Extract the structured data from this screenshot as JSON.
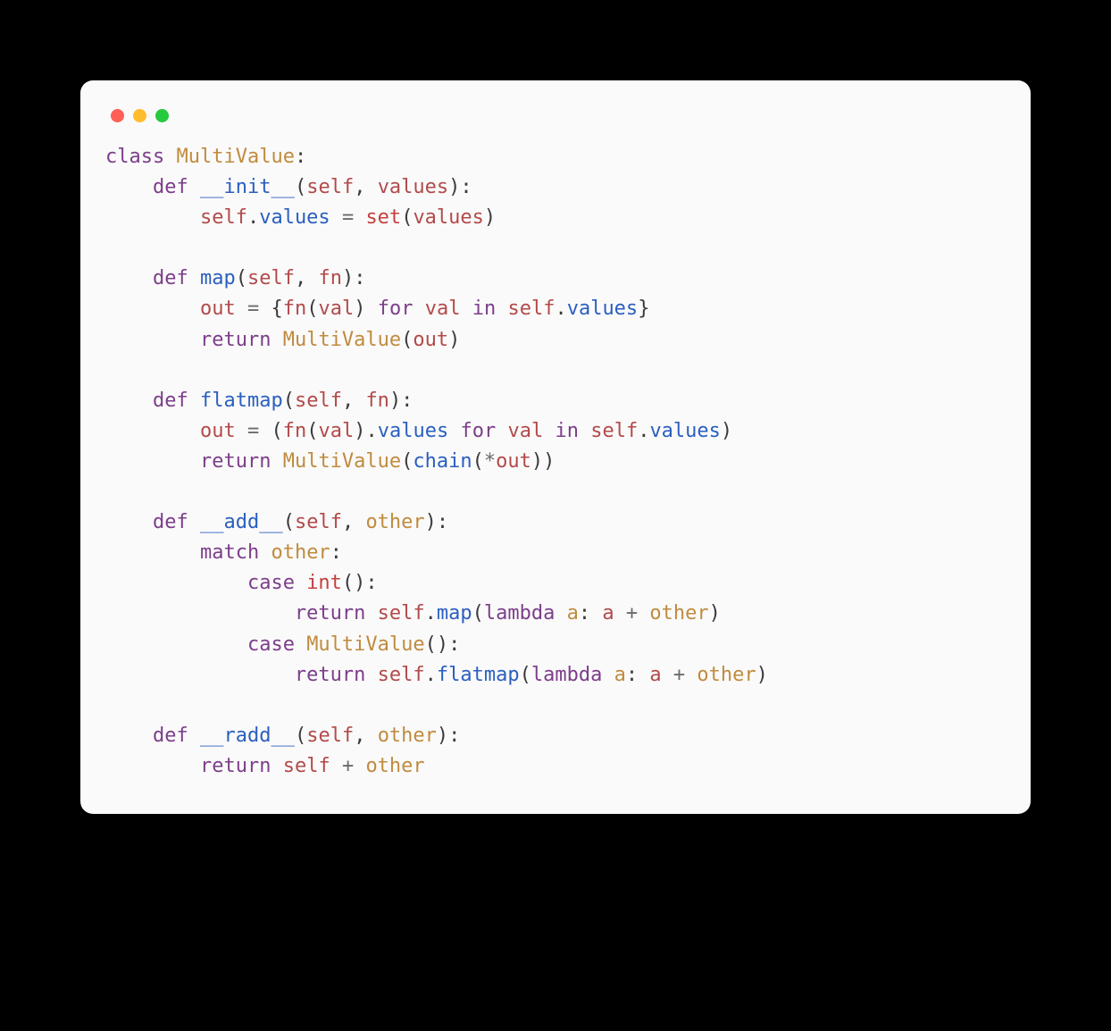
{
  "window": {
    "traffic_light_colors": {
      "close": "#ff5f56",
      "minimize": "#ffbd2e",
      "zoom": "#27c93f"
    }
  },
  "code": {
    "language": "python",
    "tokens": [
      [
        [
          "kw",
          "class"
        ],
        [
          "sp",
          " "
        ],
        [
          "cls",
          "MultiValue"
        ],
        [
          "pn",
          ":"
        ]
      ],
      [
        [
          "sp",
          "    "
        ],
        [
          "kw",
          "def"
        ],
        [
          "sp",
          " "
        ],
        [
          "fn",
          "__init__"
        ],
        [
          "pn",
          "("
        ],
        [
          "prm",
          "self"
        ],
        [
          "pn",
          ","
        ],
        [
          "sp",
          " "
        ],
        [
          "prm",
          "values"
        ],
        [
          "pn",
          "):"
        ]
      ],
      [
        [
          "sp",
          "        "
        ],
        [
          "prm",
          "self"
        ],
        [
          "pn",
          "."
        ],
        [
          "fn",
          "values"
        ],
        [
          "sp",
          " "
        ],
        [
          "op",
          "="
        ],
        [
          "sp",
          " "
        ],
        [
          "bi",
          "set"
        ],
        [
          "pn",
          "("
        ],
        [
          "prm",
          "values"
        ],
        [
          "pn",
          ")"
        ]
      ],
      [],
      [
        [
          "sp",
          "    "
        ],
        [
          "kw",
          "def"
        ],
        [
          "sp",
          " "
        ],
        [
          "fn",
          "map"
        ],
        [
          "pn",
          "("
        ],
        [
          "prm",
          "self"
        ],
        [
          "pn",
          ","
        ],
        [
          "sp",
          " "
        ],
        [
          "prm",
          "fn"
        ],
        [
          "pn",
          "):"
        ]
      ],
      [
        [
          "sp",
          "        "
        ],
        [
          "prm",
          "out"
        ],
        [
          "sp",
          " "
        ],
        [
          "op",
          "="
        ],
        [
          "sp",
          " "
        ],
        [
          "pn",
          "{"
        ],
        [
          "prm",
          "fn"
        ],
        [
          "pn",
          "("
        ],
        [
          "prm",
          "val"
        ],
        [
          "pn",
          ")"
        ],
        [
          "sp",
          " "
        ],
        [
          "kw",
          "for"
        ],
        [
          "sp",
          " "
        ],
        [
          "prm",
          "val"
        ],
        [
          "sp",
          " "
        ],
        [
          "kw",
          "in"
        ],
        [
          "sp",
          " "
        ],
        [
          "prm",
          "self"
        ],
        [
          "pn",
          "."
        ],
        [
          "fn",
          "values"
        ],
        [
          "pn",
          "}"
        ]
      ],
      [
        [
          "sp",
          "        "
        ],
        [
          "kw",
          "return"
        ],
        [
          "sp",
          " "
        ],
        [
          "cls",
          "MultiValue"
        ],
        [
          "pn",
          "("
        ],
        [
          "prm",
          "out"
        ],
        [
          "pn",
          ")"
        ]
      ],
      [],
      [
        [
          "sp",
          "    "
        ],
        [
          "kw",
          "def"
        ],
        [
          "sp",
          " "
        ],
        [
          "fn",
          "flatmap"
        ],
        [
          "pn",
          "("
        ],
        [
          "prm",
          "self"
        ],
        [
          "pn",
          ","
        ],
        [
          "sp",
          " "
        ],
        [
          "prm",
          "fn"
        ],
        [
          "pn",
          "):"
        ]
      ],
      [
        [
          "sp",
          "        "
        ],
        [
          "prm",
          "out"
        ],
        [
          "sp",
          " "
        ],
        [
          "op",
          "="
        ],
        [
          "sp",
          " "
        ],
        [
          "pn",
          "("
        ],
        [
          "prm",
          "fn"
        ],
        [
          "pn",
          "("
        ],
        [
          "prm",
          "val"
        ],
        [
          "pn",
          ")."
        ],
        [
          "fn",
          "values"
        ],
        [
          "sp",
          " "
        ],
        [
          "kw",
          "for"
        ],
        [
          "sp",
          " "
        ],
        [
          "prm",
          "val"
        ],
        [
          "sp",
          " "
        ],
        [
          "kw",
          "in"
        ],
        [
          "sp",
          " "
        ],
        [
          "prm",
          "self"
        ],
        [
          "pn",
          "."
        ],
        [
          "fn",
          "values"
        ],
        [
          "pn",
          ")"
        ]
      ],
      [
        [
          "sp",
          "        "
        ],
        [
          "kw",
          "return"
        ],
        [
          "sp",
          " "
        ],
        [
          "cls",
          "MultiValue"
        ],
        [
          "pn",
          "("
        ],
        [
          "fn",
          "chain"
        ],
        [
          "pn",
          "("
        ],
        [
          "op",
          "*"
        ],
        [
          "prm",
          "out"
        ],
        [
          "pn",
          "))"
        ]
      ],
      [],
      [
        [
          "sp",
          "    "
        ],
        [
          "kw",
          "def"
        ],
        [
          "sp",
          " "
        ],
        [
          "fn",
          "__add__"
        ],
        [
          "pn",
          "("
        ],
        [
          "prm",
          "self"
        ],
        [
          "pn",
          ","
        ],
        [
          "sp",
          " "
        ],
        [
          "cls",
          "other"
        ],
        [
          "pn",
          "):"
        ]
      ],
      [
        [
          "sp",
          "        "
        ],
        [
          "kw",
          "match"
        ],
        [
          "sp",
          " "
        ],
        [
          "cls",
          "other"
        ],
        [
          "pn",
          ":"
        ]
      ],
      [
        [
          "sp",
          "            "
        ],
        [
          "kw",
          "case"
        ],
        [
          "sp",
          " "
        ],
        [
          "bi",
          "int"
        ],
        [
          "pn",
          "():"
        ]
      ],
      [
        [
          "sp",
          "                "
        ],
        [
          "kw",
          "return"
        ],
        [
          "sp",
          " "
        ],
        [
          "prm",
          "self"
        ],
        [
          "pn",
          "."
        ],
        [
          "fn",
          "map"
        ],
        [
          "pn",
          "("
        ],
        [
          "kw",
          "lambda"
        ],
        [
          "sp",
          " "
        ],
        [
          "cls",
          "a"
        ],
        [
          "pn",
          ":"
        ],
        [
          "sp",
          " "
        ],
        [
          "prm",
          "a"
        ],
        [
          "sp",
          " "
        ],
        [
          "op",
          "+"
        ],
        [
          "sp",
          " "
        ],
        [
          "cls",
          "other"
        ],
        [
          "pn",
          ")"
        ]
      ],
      [
        [
          "sp",
          "            "
        ],
        [
          "kw",
          "case"
        ],
        [
          "sp",
          " "
        ],
        [
          "cls",
          "MultiValue"
        ],
        [
          "pn",
          "():"
        ]
      ],
      [
        [
          "sp",
          "                "
        ],
        [
          "kw",
          "return"
        ],
        [
          "sp",
          " "
        ],
        [
          "prm",
          "self"
        ],
        [
          "pn",
          "."
        ],
        [
          "fn",
          "flatmap"
        ],
        [
          "pn",
          "("
        ],
        [
          "kw",
          "lambda"
        ],
        [
          "sp",
          " "
        ],
        [
          "cls",
          "a"
        ],
        [
          "pn",
          ":"
        ],
        [
          "sp",
          " "
        ],
        [
          "prm",
          "a"
        ],
        [
          "sp",
          " "
        ],
        [
          "op",
          "+"
        ],
        [
          "sp",
          " "
        ],
        [
          "cls",
          "other"
        ],
        [
          "pn",
          ")"
        ]
      ],
      [],
      [
        [
          "sp",
          "    "
        ],
        [
          "kw",
          "def"
        ],
        [
          "sp",
          " "
        ],
        [
          "fn",
          "__radd__"
        ],
        [
          "pn",
          "("
        ],
        [
          "prm",
          "self"
        ],
        [
          "pn",
          ","
        ],
        [
          "sp",
          " "
        ],
        [
          "cls",
          "other"
        ],
        [
          "pn",
          "):"
        ]
      ],
      [
        [
          "sp",
          "        "
        ],
        [
          "kw",
          "return"
        ],
        [
          "sp",
          " "
        ],
        [
          "prm",
          "self"
        ],
        [
          "sp",
          " "
        ],
        [
          "op",
          "+"
        ],
        [
          "sp",
          " "
        ],
        [
          "cls",
          "other"
        ]
      ]
    ]
  }
}
